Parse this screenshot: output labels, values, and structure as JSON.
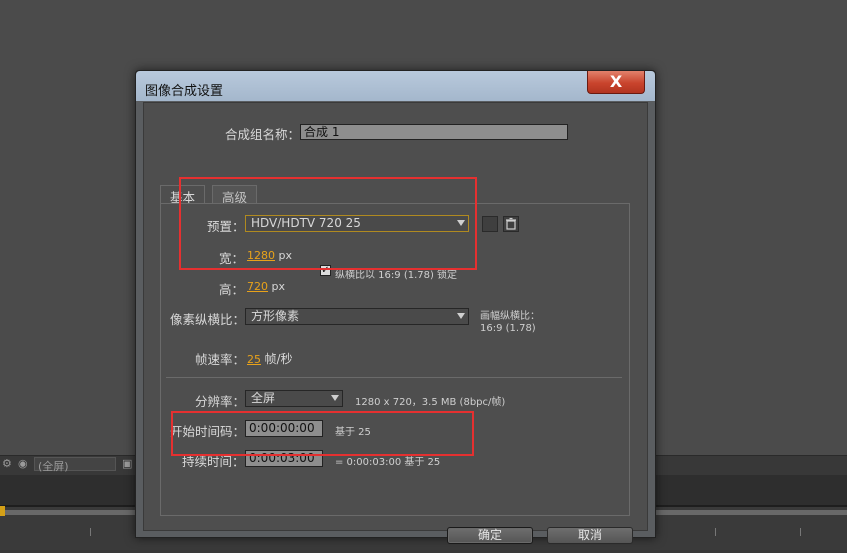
{
  "background": {
    "toolbar_select": "(全屏)"
  },
  "window": {
    "title": "图像合成设置",
    "close_label": "X"
  },
  "composition": {
    "name_label": "合成组名称：",
    "name_value": "合成 1"
  },
  "tabs": [
    {
      "label": "基本"
    },
    {
      "label": "高级"
    }
  ],
  "basic": {
    "preset_label": "预置：",
    "preset_value": "HDV/HDTV 720 25",
    "width_label": "宽：",
    "width_value": "1280",
    "width_unit": "px",
    "height_label": "高：",
    "height_value": "720",
    "height_unit": "px",
    "lock_aspect_label": "纵横比以 16:9 (1.78) 锁定",
    "pixel_aspect_label": "像素纵横比：",
    "pixel_aspect_value": "方形像素",
    "frame_aspect_label": "画幅纵横比：",
    "frame_aspect_value": "16:9 (1.78)",
    "frame_rate_label": "帧速率：",
    "frame_rate_value": "25",
    "frame_rate_unit": "帧/秒",
    "resolution_label": "分辨率：",
    "resolution_value": "全屏",
    "resolution_info": "1280 x 720，3.5 MB (8bpc/帧)",
    "start_timecode_label": "开始时间码：",
    "start_timecode_value": "0:00:00:00",
    "start_timecode_base": "基于 25",
    "duration_label": "持续时间：",
    "duration_value": "0:00:03:00",
    "duration_info": "= 0:00:03:00  基于 25"
  },
  "buttons": {
    "ok": "确定",
    "cancel": "取消"
  },
  "colors": {
    "highlight_value": "#e8a21a",
    "annotation_box": "#e53030"
  }
}
